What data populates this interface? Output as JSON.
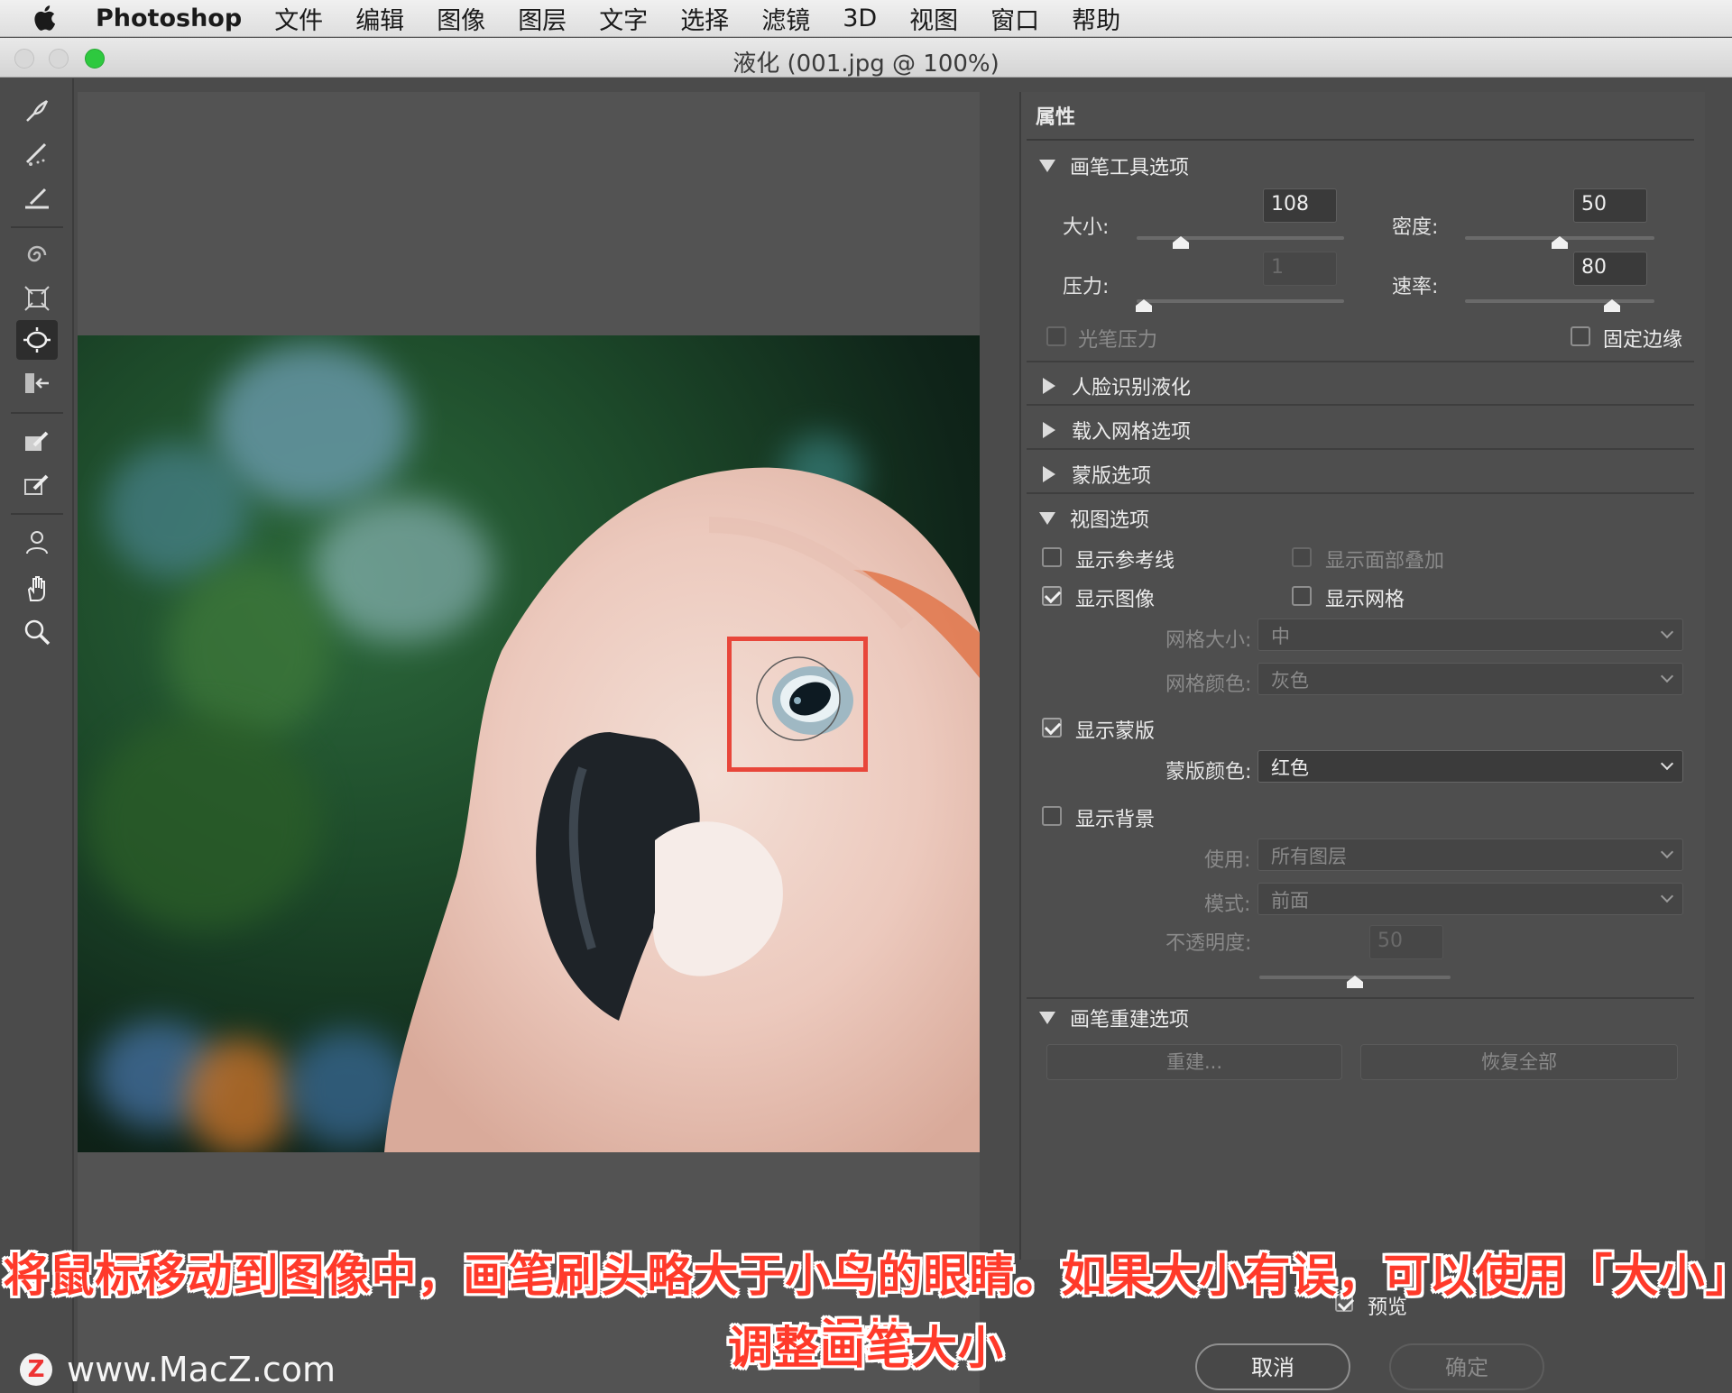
{
  "menubar": {
    "app": "Photoshop",
    "items": [
      "文件",
      "编辑",
      "图像",
      "图层",
      "文字",
      "选择",
      "滤镜",
      "3D",
      "视图",
      "窗口",
      "帮助"
    ]
  },
  "window": {
    "title": "液化 (001.jpg @ 100%)"
  },
  "toolbar": {
    "tools": [
      "forward-warp-icon",
      "reconstruct-icon",
      "smooth-icon",
      "twirl-icon",
      "pucker-icon",
      "bloat-icon",
      "push-left-icon",
      "freeze-mask-icon",
      "thaw-mask-icon",
      "face-tool-icon",
      "hand-icon",
      "zoom-icon"
    ],
    "active": "bloat-icon"
  },
  "panel": {
    "header": "属性",
    "brush": {
      "title": "画笔工具选项",
      "size_label": "大小:",
      "size_value": "108",
      "density_label": "密度:",
      "density_value": "50",
      "pressure_label": "压力:",
      "pressure_value": "1",
      "rate_label": "速率:",
      "rate_value": "80",
      "stylus_label": "光笔压力",
      "pin_edges_label": "固定边缘"
    },
    "collapsed": {
      "face": "人脸识别液化",
      "mesh": "载入网格选项",
      "mask": "蒙版选项"
    },
    "view": {
      "title": "视图选项",
      "guides": "显示参考线",
      "face_overlay": "显示面部叠加",
      "image": "显示图像",
      "mesh": "显示网格",
      "mesh_size_label": "网格大小:",
      "mesh_size_value": "中",
      "mesh_color_label": "网格颜色:",
      "mesh_color_value": "灰色",
      "show_mask": "显示蒙版",
      "mask_color_label": "蒙版颜色:",
      "mask_color_value": "红色",
      "show_backdrop": "显示背景",
      "use_label": "使用:",
      "use_value": "所有图层",
      "mode_label": "模式:",
      "mode_value": "前面",
      "opacity_label": "不透明度:",
      "opacity_value": "50"
    },
    "reconstruct": {
      "title": "画笔重建选项",
      "reconstruct_btn": "重建...",
      "restore_btn": "恢复全部"
    },
    "preview_label": "预览",
    "cancel": "取消",
    "ok": "确定"
  },
  "caption": {
    "line1": "将鼠标移动到图像中，画笔刷头略大于小鸟的眼睛。如果大小有误，可以使用「大小」滑块",
    "line2": "调整画笔大小"
  },
  "watermark": {
    "logo": "Z",
    "text": "www.MacZ.com"
  },
  "colors": {
    "highlight": "#e8463a",
    "caption": "#ff3a2a",
    "panel_bg": "#4e4e4e"
  }
}
